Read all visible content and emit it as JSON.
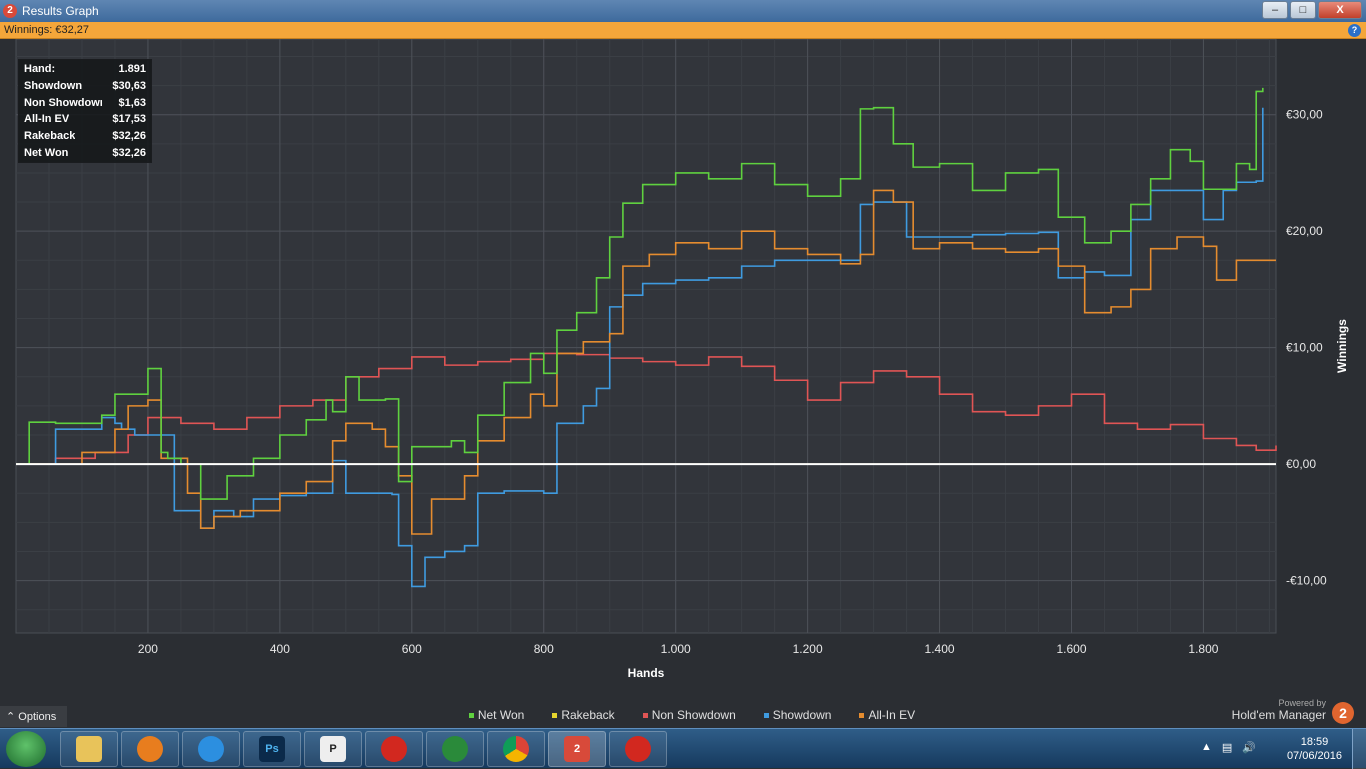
{
  "window": {
    "title": "Results Graph",
    "app_icon": "2",
    "minimize": "–",
    "maximize": "□",
    "close": "X"
  },
  "winnings_bar": {
    "label": "Winnings: €32,27",
    "help": "?"
  },
  "tooltip": [
    {
      "k": "Hand:",
      "v": "1.891"
    },
    {
      "k": "Showdown",
      "v": "$30,63"
    },
    {
      "k": "Non Showdown",
      "v": "$1,63"
    },
    {
      "k": "All-In EV",
      "v": "$17,53"
    },
    {
      "k": "Rakeback",
      "v": "$32,26"
    },
    {
      "k": "Net Won",
      "v": "$32,26"
    }
  ],
  "footer": {
    "options": "Options",
    "powered_by": "Powered by",
    "brand": "Hold'em Manager",
    "brand_logo": "2"
  },
  "taskbar": {
    "items": [
      "explorer-icon",
      "blender-icon",
      "ie-icon",
      "photoshop-icon",
      "pokerx-icon",
      "pokerstars-icon",
      "cards-icon",
      "chrome-icon",
      "hm2-icon",
      "pokerstars-icon-2"
    ],
    "labels": {
      "photoshop": "Ps",
      "pokerx": "P",
      "hm2": "2"
    },
    "time": "18:59",
    "date": "07/06/2016"
  },
  "chart_data": {
    "type": "line",
    "xlabel": "Hands",
    "ylabel": "Winnings",
    "xlim": [
      0,
      1910
    ],
    "ylim": [
      -14.5,
      36.5
    ],
    "x_ticks": [
      200,
      400,
      600,
      800,
      1000,
      1200,
      1400,
      1600,
      1800
    ],
    "x_tick_labels": [
      "200",
      "400",
      "600",
      "800",
      "1.000",
      "1.200",
      "1.400",
      "1.600",
      "1.800"
    ],
    "y_ticks": [
      -10,
      0,
      10,
      20,
      30
    ],
    "y_tick_labels": [
      "-€10,00",
      "€0,00",
      "€10,00",
      "€20,00",
      "€30,00"
    ],
    "grid": true,
    "legend_position": "bottom",
    "series": [
      {
        "name": "Net Won",
        "color": "#5fd13f",
        "x": [
          0,
          20,
          60,
          100,
          130,
          150,
          200,
          220,
          230,
          250,
          280,
          320,
          360,
          400,
          440,
          470,
          480,
          500,
          520,
          560,
          580,
          600,
          630,
          660,
          680,
          700,
          740,
          780,
          800,
          820,
          850,
          880,
          900,
          920,
          950,
          1000,
          1050,
          1100,
          1150,
          1200,
          1250,
          1280,
          1300,
          1330,
          1360,
          1400,
          1450,
          1500,
          1550,
          1580,
          1620,
          1660,
          1690,
          1720,
          1750,
          1780,
          1800,
          1850,
          1870,
          1880,
          1890
        ],
        "y": [
          0,
          3.6,
          3.5,
          3.5,
          4.2,
          6,
          8.2,
          1,
          0.5,
          0,
          -3,
          -1,
          0.5,
          2.5,
          3.8,
          5.5,
          4.5,
          7.5,
          5.5,
          5.6,
          -1.5,
          1.5,
          1.5,
          2,
          1,
          4.2,
          7,
          9.5,
          7.8,
          11.5,
          13,
          16,
          19.5,
          22.4,
          24,
          25,
          24.5,
          25.8,
          24,
          23,
          24.5,
          30.5,
          30.6,
          27.5,
          25.5,
          25.8,
          23.5,
          25,
          25.3,
          21.2,
          19,
          20,
          22.3,
          24.5,
          27,
          26,
          23.6,
          25.8,
          25.3,
          32,
          32.3
        ]
      },
      {
        "name": "Rakeback",
        "color": "#e6d52e",
        "x": [
          0,
          1910
        ],
        "y": [
          0,
          0
        ]
      },
      {
        "name": "Non Showdown",
        "color": "#e05555",
        "x": [
          0,
          60,
          120,
          170,
          200,
          250,
          300,
          350,
          400,
          450,
          500,
          550,
          600,
          650,
          700,
          750,
          800,
          850,
          900,
          950,
          1000,
          1050,
          1100,
          1150,
          1200,
          1250,
          1300,
          1350,
          1400,
          1450,
          1500,
          1550,
          1600,
          1650,
          1700,
          1750,
          1800,
          1850,
          1880,
          1910
        ],
        "y": [
          0,
          0.5,
          1,
          2.5,
          4,
          3.5,
          3,
          4,
          5,
          5.5,
          7.5,
          8.2,
          9.2,
          8.5,
          8.8,
          9,
          9.5,
          9.4,
          9.1,
          8.8,
          8.5,
          9.2,
          8.4,
          7.2,
          5.5,
          7,
          8,
          7.5,
          6,
          4.5,
          4.2,
          5,
          6,
          3.5,
          3,
          3.4,
          2.2,
          1.6,
          1.2,
          1.6
        ]
      },
      {
        "name": "Showdown",
        "color": "#3f9be0",
        "x": [
          0,
          60,
          100,
          130,
          150,
          160,
          180,
          240,
          280,
          300,
          330,
          360,
          400,
          440,
          480,
          500,
          540,
          570,
          580,
          600,
          620,
          650,
          680,
          700,
          740,
          780,
          800,
          820,
          860,
          880,
          900,
          920,
          950,
          1000,
          1050,
          1100,
          1150,
          1200,
          1250,
          1280,
          1300,
          1350,
          1400,
          1450,
          1500,
          1550,
          1580,
          1620,
          1650,
          1690,
          1720,
          1760,
          1800,
          1830,
          1850,
          1880,
          1890
        ],
        "y": [
          0,
          3,
          3,
          4,
          3.5,
          3,
          2.5,
          -4,
          -5.5,
          -4,
          -4.5,
          -3,
          -2.7,
          -2.5,
          0.3,
          -2.5,
          -2.5,
          -2.6,
          -7,
          -10.5,
          -8,
          -7.5,
          -7,
          -2.5,
          -2.3,
          -2.3,
          -2.5,
          3.5,
          5,
          6.5,
          13.5,
          14.5,
          15.5,
          15.8,
          16,
          17,
          17.5,
          17.5,
          17.5,
          22.3,
          22.5,
          19.5,
          19.5,
          19.7,
          19.8,
          19.9,
          16,
          16.5,
          16.2,
          21,
          23.5,
          23.5,
          21,
          23.5,
          24.2,
          24.3,
          30.6
        ]
      },
      {
        "name": "All-In EV",
        "color": "#e58c2f",
        "x": [
          0,
          60,
          100,
          150,
          170,
          200,
          220,
          260,
          280,
          300,
          340,
          400,
          440,
          480,
          500,
          540,
          560,
          580,
          600,
          630,
          660,
          680,
          700,
          740,
          780,
          800,
          820,
          860,
          880,
          900,
          920,
          960,
          1000,
          1050,
          1100,
          1150,
          1200,
          1250,
          1280,
          1300,
          1330,
          1360,
          1400,
          1450,
          1500,
          1550,
          1580,
          1620,
          1660,
          1690,
          1720,
          1760,
          1800,
          1820,
          1850,
          1880,
          1910
        ],
        "y": [
          0,
          0,
          1,
          3,
          5,
          5.5,
          0.5,
          -2.5,
          -5.5,
          -4.5,
          -4,
          -2.5,
          -1.5,
          2,
          3.5,
          3,
          1.5,
          -1,
          -6,
          -3,
          -3,
          -1,
          2,
          4,
          6,
          5,
          9.5,
          10.5,
          10.5,
          11.2,
          17,
          18,
          19,
          18.5,
          20,
          18.5,
          18,
          17.2,
          18,
          23.5,
          22.5,
          18.5,
          19,
          18.5,
          18.2,
          18.5,
          17,
          13,
          13.5,
          15,
          18.5,
          19.5,
          18.7,
          15.8,
          17.5,
          17.5,
          17.5
        ]
      }
    ],
    "zero_line_color": "#ffffff"
  }
}
